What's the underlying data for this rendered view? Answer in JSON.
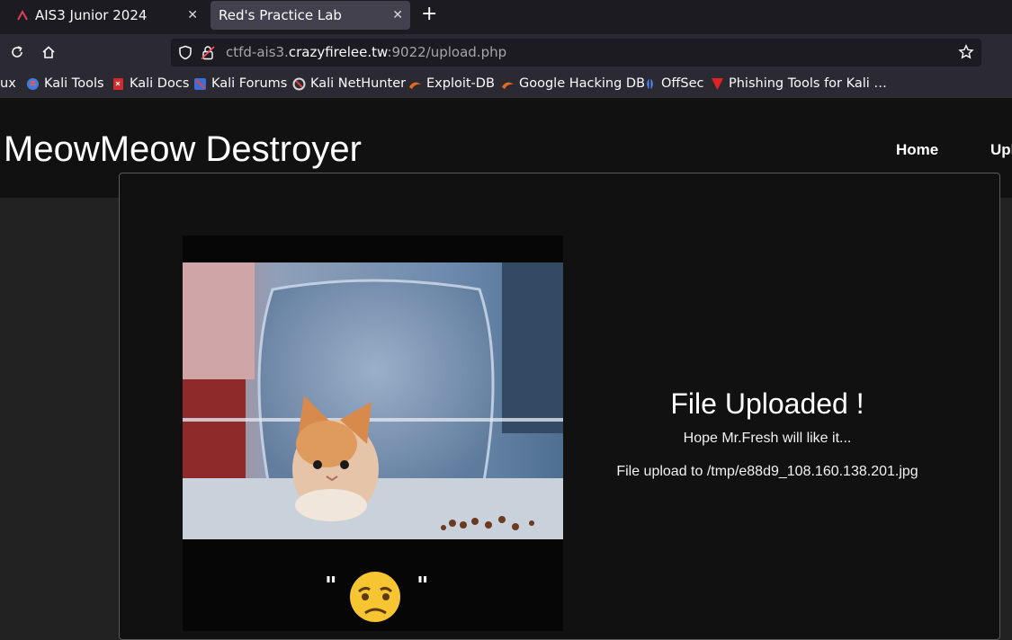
{
  "browser": {
    "tabs": [
      {
        "label": "AIS3 Junior 2024",
        "active": false
      },
      {
        "label": "Red's Practice Lab",
        "active": true
      }
    ],
    "url": {
      "prefix": "ctfd-ais3.",
      "domain": "crazyfirelee.tw",
      "suffix": ":9022/upload.php"
    },
    "bookmarks": [
      {
        "label": "ux"
      },
      {
        "label": "Kali Tools"
      },
      {
        "label": "Kali Docs"
      },
      {
        "label": "Kali Forums"
      },
      {
        "label": "Kali NetHunter"
      },
      {
        "label": "Exploit-DB"
      },
      {
        "label": "Google Hacking DB"
      },
      {
        "label": "OffSec"
      },
      {
        "label": "Phishing Tools for Kali …"
      }
    ]
  },
  "site": {
    "title": "MeowMeow Destroyer",
    "nav": [
      {
        "label": "Home"
      },
      {
        "label": "Upl"
      }
    ]
  },
  "result": {
    "heading": "File Uploaded !",
    "message": "Hope Mr.Fresh will like it...",
    "path": "File upload to /tmp/e88d9_108.160.138.201.jpg"
  },
  "gif": {
    "caption_left": "\"",
    "caption_right": "\""
  },
  "colors": {
    "page_bg": "#222222",
    "header_bg": "#111111",
    "tab_active": "#42414d",
    "toolbar": "#2b2a33"
  }
}
